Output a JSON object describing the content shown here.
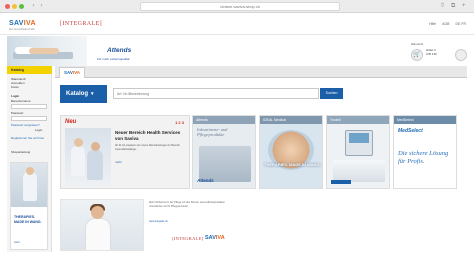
{
  "browser": {
    "url": "viviane.saviva-shop.ch",
    "controls": [
      "‹",
      "›"
    ],
    "right_icons": [
      "⇧",
      "⧉",
      "+"
    ]
  },
  "header": {
    "brand_part1": "SAV",
    "brand_part2": "IVA",
    "brand_sub": "Die Gesundheits-Profis",
    "partner": "[INTEGRALE]",
    "links": [
      "Hilfe",
      "AGB",
      "DE  FR"
    ]
  },
  "banner": {
    "attends_logo": "Attends",
    "attends_tagline": "Für mehr Lebensqualität",
    "cart_label": "Warenkorb",
    "cart_icon": "🛒",
    "cart_text_line1": "Artikel: 0",
    "cart_text_line2": "CHF 0.00"
  },
  "sidebar": {
    "katalog": "Katalog",
    "items": [
      "Warenkorb",
      "Anmelden",
      "Konto"
    ],
    "login_label": "Login",
    "user_label": "Benutzername",
    "password_label": "Passwort",
    "forgot": "Passwort vergessen?",
    "login_btn": "Login",
    "register": "Registrieren Sie sich hier",
    "shop_link": "Shopanleitung",
    "ad_title_line1": "THERAPIES.",
    "ad_title_line2": "MADE IN WANG.",
    "ad_more": "mehr"
  },
  "main": {
    "tab_label_part1": "SAV",
    "tab_label_part2": "IVA",
    "katalog_button": "Katalog",
    "search_placeholder": "Art. Nr./Bezeichnung",
    "search_button": "Suchen",
    "feature": {
      "tag": "Neu",
      "pager": "1 2 3",
      "title": "Neuer Bereich Health Services von Saviva",
      "text": "Ab 01.01 erweitern wir unsere Dienstleistungen im Bereich Gesundheitspflege.",
      "more": "mehr"
    },
    "tiles": [
      {
        "head": "Attends",
        "body": "Inkontinenz- und Pflegeprodukte",
        "logo": "Attends"
      },
      {
        "head": "IDEAL Medical",
        "body": "THERAPIES. MADE IN WANG."
      },
      {
        "head": "Trudell",
        "body": ""
      },
      {
        "head": "MedSelect",
        "logo": "MedSelect",
        "body": "Die sichere Lösung für Profis."
      }
    ],
    "lower": {
      "text": "Mehr Sicherheit in der Pflege mit den Kleinen Gesundheitsprodukten unterstützen wir Ihr Pflegepersonal.",
      "link": "www.integrale.ch",
      "partner": "[INTEGRALE]",
      "brand_part1": "SAV",
      "brand_part2": "IVA"
    }
  }
}
